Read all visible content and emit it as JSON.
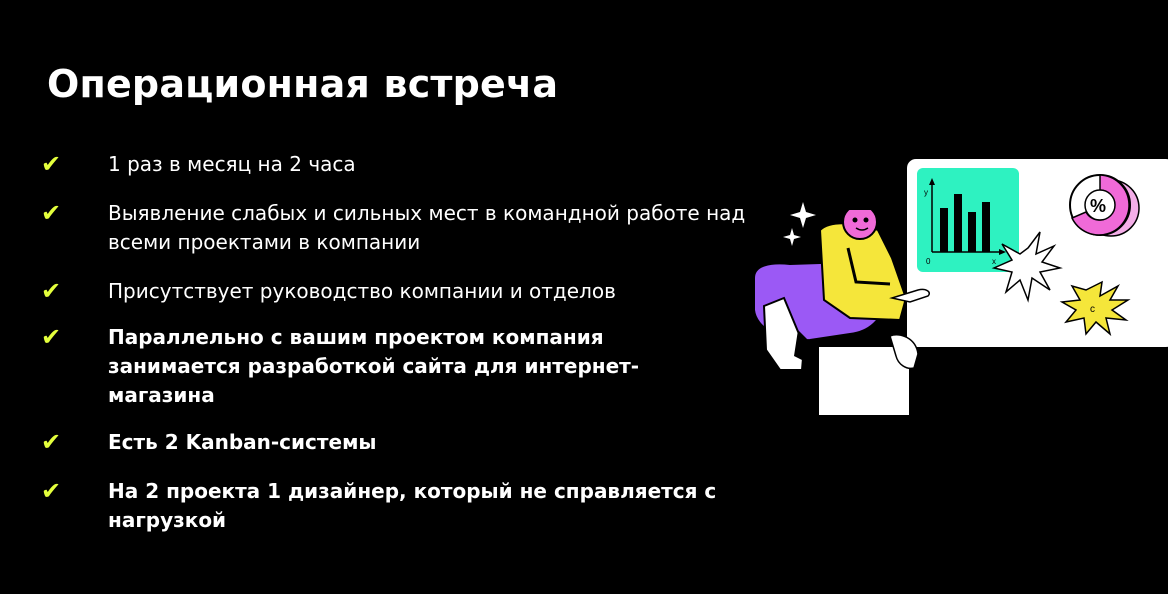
{
  "slide": {
    "title": "Операционная встреча",
    "accent_color": "#e4ff3c",
    "background_color": "#000000"
  },
  "bullets": [
    {
      "icon": "check-icon",
      "text": "1 раз в месяц на 2 часа",
      "bold": false
    },
    {
      "icon": "check-icon",
      "text": "Выявление слабых и сильных мест в командной работе над всеми проектами в компании",
      "bold": false
    },
    {
      "icon": "check-icon",
      "text": "Присутствует руководство компании и отделов",
      "bold": false
    },
    {
      "icon": "check-icon",
      "text": "Параллельно с вашим проектом компания занимается разработкой сайта для интернет-магазина",
      "bold": true
    },
    {
      "icon": "check-icon",
      "text": "Есть 2 Kanban-системы",
      "bold": true
    },
    {
      "icon": "check-icon",
      "text": "На 2 проекта 1 дизайнер, который не справляется с нагрузкой",
      "bold": true
    }
  ],
  "illustration": {
    "chart_axis_y": "y",
    "chart_axis_x": "x",
    "chart_origin": "0",
    "percent_symbol": "%",
    "colors": {
      "mint": "#2ef2c1",
      "purple": "#9b59f5",
      "yellow": "#f5e63a",
      "pink": "#f06ad8",
      "skin": "#f05fd0"
    }
  }
}
